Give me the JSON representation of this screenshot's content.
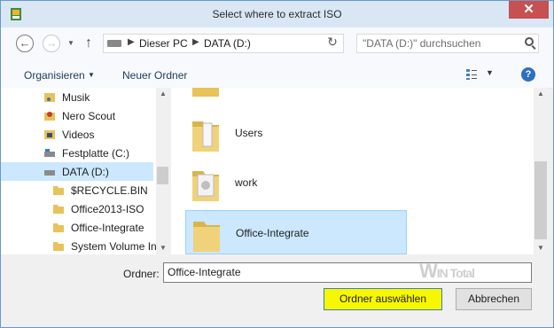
{
  "window": {
    "title": "Select where to extract ISO",
    "close_label": "✕"
  },
  "nav": {
    "back": "←",
    "forward": "→",
    "up": "↑",
    "breadcrumbs": [
      "Dieser PC",
      "DATA (D:)"
    ],
    "search_placeholder": "\"DATA (D:)\" durchsuchen"
  },
  "toolbar": {
    "organize": "Organisieren",
    "new_folder": "Neuer Ordner",
    "help": "?"
  },
  "sidebar": {
    "items": [
      {
        "label": "Musik",
        "icon": "music-folder-icon"
      },
      {
        "label": "Nero Scout",
        "icon": "nero-scout-icon"
      },
      {
        "label": "Videos",
        "icon": "video-folder-icon"
      },
      {
        "label": "Festplatte (C:)",
        "icon": "drive-c-icon"
      },
      {
        "label": "DATA (D:)",
        "icon": "drive-d-icon",
        "selected": true
      },
      {
        "label": "$RECYCLE.BIN",
        "icon": "folder-icon"
      },
      {
        "label": "Office2013-ISO",
        "icon": "folder-icon"
      },
      {
        "label": "Office-Integrate",
        "icon": "folder-icon"
      },
      {
        "label": "System Volume In",
        "icon": "folder-icon"
      }
    ]
  },
  "files": [
    {
      "label": "Users",
      "icon": "users-folder-icon"
    },
    {
      "label": "work",
      "icon": "work-folder-icon"
    },
    {
      "label": "Office-Integrate",
      "icon": "folder-icon",
      "selected": true
    }
  ],
  "bottom": {
    "folder_label": "Ordner:",
    "folder_value": "Office-Integrate",
    "select_button": "Ordner auswählen",
    "cancel_button": "Abbrechen"
  },
  "watermark": "WIN Total",
  "colors": {
    "titlebar": "#d9e7f4",
    "selection": "#cce8ff",
    "primary_button": "#f7f700",
    "close_button": "#c75050"
  }
}
